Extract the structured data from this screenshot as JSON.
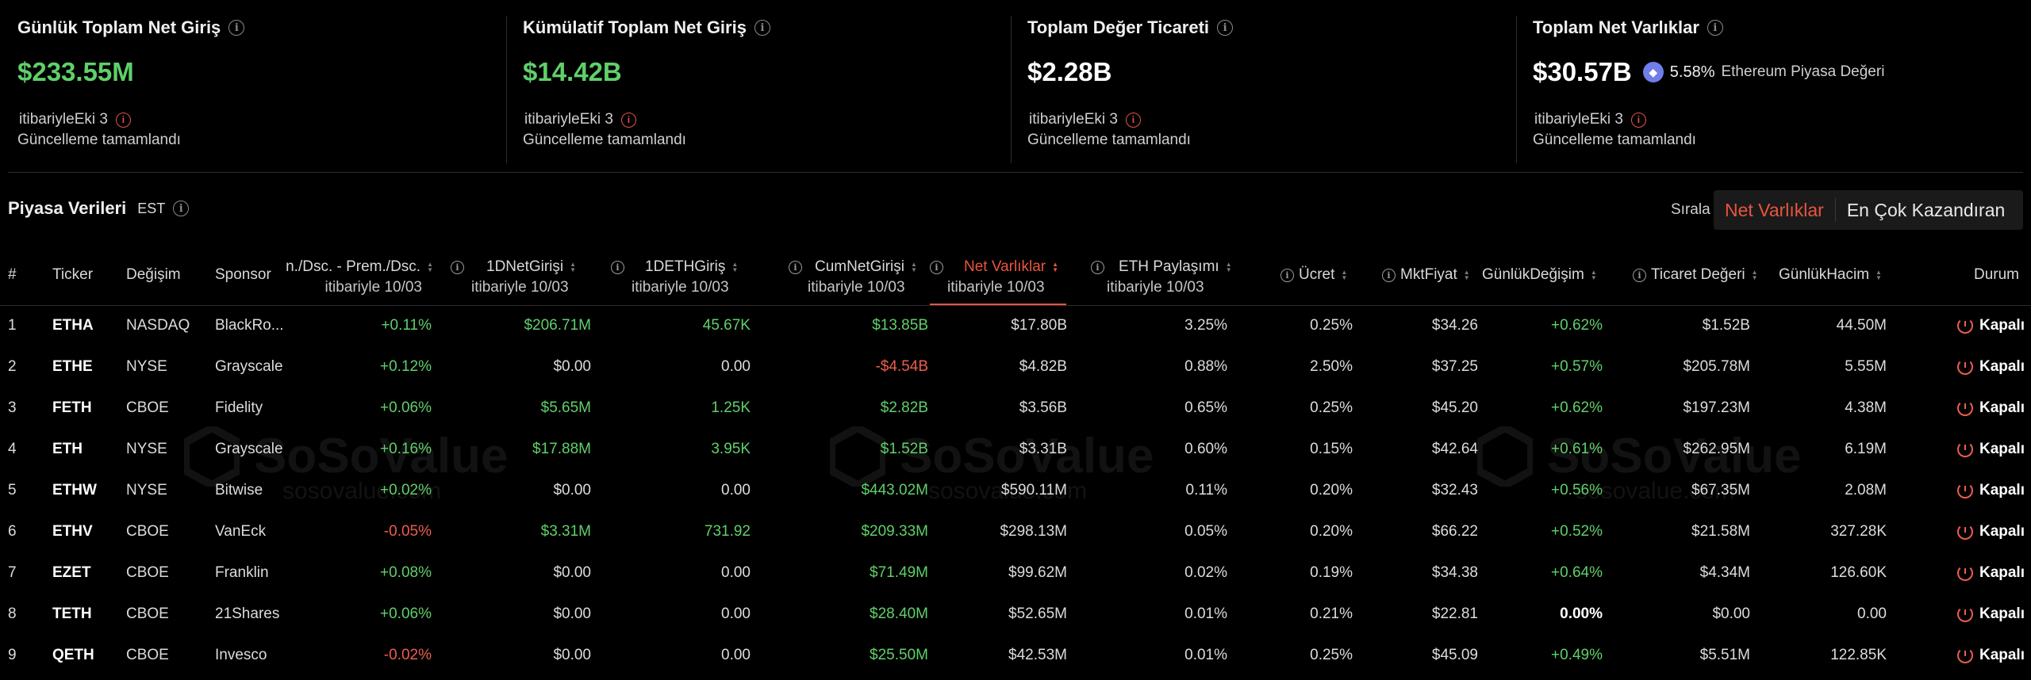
{
  "cards": [
    {
      "title": "Günlük Toplam Net Giriş",
      "value": "$233.55M",
      "value_color": "green",
      "asof": "itibariyleEki 3",
      "status": "Güncelleme tamamlandı"
    },
    {
      "title": "Kümülatif Toplam Net Giriş",
      "value": "$14.42B",
      "value_color": "green",
      "asof": "itibariyleEki 3",
      "status": "Güncelleme tamamlandı"
    },
    {
      "title": "Toplam Değer Ticareti",
      "value": "$2.28B",
      "value_color": "white",
      "asof": "itibariyleEki 3",
      "status": "Güncelleme tamamlandı"
    },
    {
      "title": "Toplam Net Varlıklar",
      "value": "$30.57B",
      "value_color": "white",
      "pct": "5.58%",
      "pct_label": "Ethereum Piyasa Değeri",
      "asof": "itibariyleEki 3",
      "status": "Güncelleme tamamlandı"
    }
  ],
  "market": {
    "title": "Piyasa Verileri",
    "tz": "EST",
    "sort_label": "Sırala",
    "sort_options": [
      "Net Varlıklar",
      "En Çok Kazandıran"
    ]
  },
  "columns": {
    "num": "#",
    "ticker": "Ticker",
    "exchange": "Değişim",
    "sponsor": "Sponsor",
    "prem": "n./Dsc. - Prem./Dsc.",
    "prem_sub": "itibariyle 10/03",
    "d1net": "1DNetGirişi",
    "d1net_sub": "itibariyle 10/03",
    "d1eth": "1DETHGiriş",
    "d1eth_sub": "itibariyle 10/03",
    "cum": "CumNetGirişi",
    "cum_sub": "itibariyle 10/03",
    "netassets": "Net Varlıklar",
    "netassets_sub": "itibariyle 10/03",
    "ethshare": "ETH Paylaşımı",
    "ethshare_sub": "itibariyle 10/03",
    "fee": "Ücret",
    "mkt": "MktFiyat",
    "daychg": "GünlükDeğişim",
    "trade": "Ticaret Değeri",
    "vol": "GünlükHacim",
    "status": "Durum"
  },
  "rows": [
    {
      "n": "1",
      "ticker": "ETHA",
      "ex": "NASDAQ",
      "sponsor": "BlackRo...",
      "prem": "+0.11%",
      "d1net": "$206.71M",
      "d1eth": "45.67K",
      "cum": "$13.85B",
      "net": "$17.80B",
      "share": "3.25%",
      "fee": "0.25%",
      "mkt": "$34.26",
      "chg": "+0.62%",
      "trade": "$1.52B",
      "vol": "44.50M",
      "status": "Kapalı"
    },
    {
      "n": "2",
      "ticker": "ETHE",
      "ex": "NYSE",
      "sponsor": "Grayscale",
      "prem": "+0.12%",
      "d1net": "$0.00",
      "d1eth": "0.00",
      "cum": "-$4.54B",
      "net": "$4.82B",
      "share": "0.88%",
      "fee": "2.50%",
      "mkt": "$37.25",
      "chg": "+0.57%",
      "trade": "$205.78M",
      "vol": "5.55M",
      "status": "Kapalı"
    },
    {
      "n": "3",
      "ticker": "FETH",
      "ex": "CBOE",
      "sponsor": "Fidelity",
      "prem": "+0.06%",
      "d1net": "$5.65M",
      "d1eth": "1.25K",
      "cum": "$2.82B",
      "net": "$3.56B",
      "share": "0.65%",
      "fee": "0.25%",
      "mkt": "$45.20",
      "chg": "+0.62%",
      "trade": "$197.23M",
      "vol": "4.38M",
      "status": "Kapalı"
    },
    {
      "n": "4",
      "ticker": "ETH",
      "ex": "NYSE",
      "sponsor": "Grayscale",
      "prem": "+0.16%",
      "d1net": "$17.88M",
      "d1eth": "3.95K",
      "cum": "$1.52B",
      "net": "$3.31B",
      "share": "0.60%",
      "fee": "0.15%",
      "mkt": "$42.64",
      "chg": "+0.61%",
      "trade": "$262.95M",
      "vol": "6.19M",
      "status": "Kapalı"
    },
    {
      "n": "5",
      "ticker": "ETHW",
      "ex": "NYSE",
      "sponsor": "Bitwise",
      "prem": "+0.02%",
      "d1net": "$0.00",
      "d1eth": "0.00",
      "cum": "$443.02M",
      "net": "$590.11M",
      "share": "0.11%",
      "fee": "0.20%",
      "mkt": "$32.43",
      "chg": "+0.56%",
      "trade": "$67.35M",
      "vol": "2.08M",
      "status": "Kapalı"
    },
    {
      "n": "6",
      "ticker": "ETHV",
      "ex": "CBOE",
      "sponsor": "VanEck",
      "prem": "-0.05%",
      "d1net": "$3.31M",
      "d1eth": "731.92",
      "cum": "$209.33M",
      "net": "$298.13M",
      "share": "0.05%",
      "fee": "0.20%",
      "mkt": "$66.22",
      "chg": "+0.52%",
      "trade": "$21.58M",
      "vol": "327.28K",
      "status": "Kapalı"
    },
    {
      "n": "7",
      "ticker": "EZET",
      "ex": "CBOE",
      "sponsor": "Franklin",
      "prem": "+0.08%",
      "d1net": "$0.00",
      "d1eth": "0.00",
      "cum": "$71.49M",
      "net": "$99.62M",
      "share": "0.02%",
      "fee": "0.19%",
      "mkt": "$34.38",
      "chg": "+0.64%",
      "trade": "$4.34M",
      "vol": "126.60K",
      "status": "Kapalı"
    },
    {
      "n": "8",
      "ticker": "TETH",
      "ex": "CBOE",
      "sponsor": "21Shares",
      "prem": "+0.06%",
      "d1net": "$0.00",
      "d1eth": "0.00",
      "cum": "$28.40M",
      "net": "$52.65M",
      "share": "0.01%",
      "fee": "0.21%",
      "mkt": "$22.81",
      "chg": "0.00%",
      "trade": "$0.00",
      "vol": "0.00",
      "status": "Kapalı"
    },
    {
      "n": "9",
      "ticker": "QETH",
      "ex": "CBOE",
      "sponsor": "Invesco",
      "prem": "-0.02%",
      "d1net": "$0.00",
      "d1eth": "0.00",
      "cum": "$25.50M",
      "net": "$42.53M",
      "share": "0.01%",
      "fee": "0.25%",
      "mkt": "$45.09",
      "chg": "+0.49%",
      "trade": "$5.51M",
      "vol": "122.85K",
      "status": "Kapalı"
    }
  ],
  "watermark": {
    "brand": "SoSoValue",
    "url": "sosovalue.com"
  },
  "colors": {
    "green": "#5fd06a",
    "red": "#ec5d4f",
    "accent": "#e8553e",
    "background": "#000000"
  }
}
